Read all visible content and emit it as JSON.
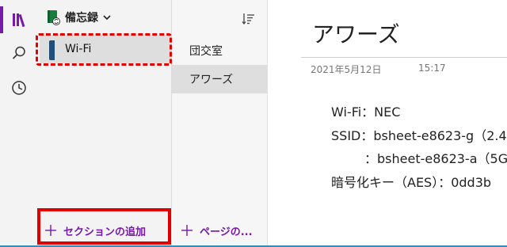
{
  "notebook": {
    "title": "備忘録"
  },
  "sections": {
    "items": [
      {
        "label": "Wi-Fi",
        "color": "#1f4e79"
      }
    ],
    "add_label": "セクションの追加"
  },
  "pages": {
    "items": [
      {
        "label": "団交室",
        "selected": false
      },
      {
        "label": "アワーズ",
        "selected": true
      }
    ],
    "add_label": "ページの..."
  },
  "note": {
    "title": "アワーズ",
    "date": "2021年5月12日",
    "time": "15:17",
    "lines": [
      "Wi-Fi：NEC",
      "SSID：bsheet-e8623-g（2.4",
      "：bsheet-e8623-a（5G",
      "暗号化キー（AES）：0dd3b"
    ]
  },
  "colors": {
    "accent": "#7719aa",
    "highlight": "#e00000",
    "section": "#1f4e79"
  },
  "icons": {
    "library": "library-icon",
    "search": "search-icon",
    "recent": "clock-icon",
    "sort": "sort-icon",
    "notebook": "notebook-sync-icon",
    "chevron": "chevron-down-icon",
    "add": "plus-icon"
  }
}
